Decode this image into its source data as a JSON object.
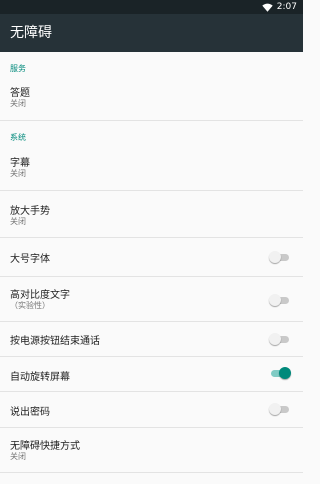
{
  "statusbar": {
    "time": "2:07",
    "wifi_icon": "wifi-icon"
  },
  "appbar": {
    "title": "无障碍"
  },
  "sections": {
    "services": {
      "header": "服务"
    },
    "system": {
      "header": "系统"
    }
  },
  "items": {
    "talkback": {
      "title": "答题",
      "summary": "关闭"
    },
    "captions": {
      "title": "字幕",
      "summary": "关闭"
    },
    "magnification": {
      "title": "放大手势",
      "summary": "关闭"
    },
    "large_text": {
      "title": "大号字体",
      "checked": false
    },
    "high_contrast": {
      "title": "高对比度文字",
      "summary": "（实验性）",
      "checked": false
    },
    "power_ends_call": {
      "title": "按电源按钮结束通话",
      "checked": false
    },
    "auto_rotate": {
      "title": "自动旋转屏幕",
      "checked": true
    },
    "speak_passwords": {
      "title": "说出密码",
      "checked": false
    },
    "shortcut": {
      "title": "无障碍快捷方式",
      "summary": "关闭"
    }
  },
  "colors": {
    "appbar": "#263238",
    "statusbar": "#1a2327",
    "accent": "#00897b",
    "background": "#fafafa"
  }
}
